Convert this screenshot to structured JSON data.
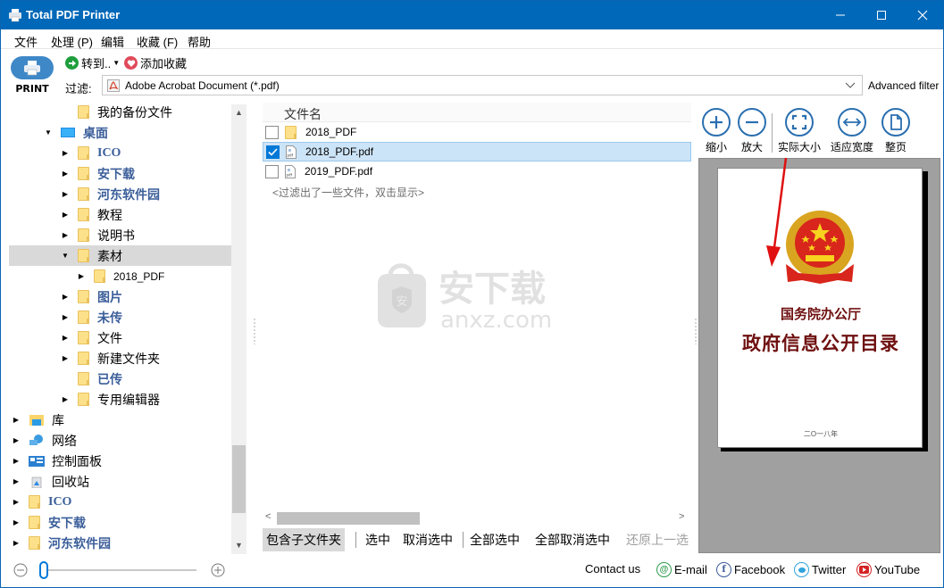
{
  "window": {
    "title": "Total PDF Printer",
    "controls": [
      "minimize",
      "maximize",
      "close"
    ]
  },
  "menu": [
    "文件",
    "处理 (P)",
    "编辑",
    "收藏 (F)",
    "帮助"
  ],
  "toolbar": {
    "print_label": "PRINT",
    "goto_label": "转到..",
    "add_favorite_label": "添加收藏",
    "filter_label": "过滤:",
    "filter_value": "Adobe Acrobat Document (*.pdf)",
    "advanced_filter_label": "Advanced filter"
  },
  "tree": {
    "items": [
      {
        "label": "我的备份文件",
        "expander": "none",
        "style": "normal"
      },
      {
        "label": "桌面",
        "expander": "expanded",
        "style": "bold-blue"
      },
      {
        "label": "ICO",
        "expander": "collapsed",
        "style": "bold-blue-serif"
      },
      {
        "label": "安下载",
        "expander": "collapsed",
        "style": "bold-blue"
      },
      {
        "label": "河东软件园",
        "expander": "collapsed",
        "style": "bold-blue"
      },
      {
        "label": "教程",
        "expander": "collapsed",
        "style": "normal"
      },
      {
        "label": "说明书",
        "expander": "collapsed",
        "style": "normal"
      },
      {
        "label": "素材",
        "expander": "expanded",
        "style": "normal",
        "selected": true
      },
      {
        "label": "2018_PDF",
        "expander": "collapsed",
        "style": "normal"
      },
      {
        "label": "图片",
        "expander": "collapsed",
        "style": "bold-blue"
      },
      {
        "label": "未传",
        "expander": "collapsed",
        "style": "bold-blue"
      },
      {
        "label": "文件",
        "expander": "collapsed",
        "style": "normal"
      },
      {
        "label": "新建文件夹",
        "expander": "collapsed",
        "style": "normal"
      },
      {
        "label": "已传",
        "expander": "none",
        "style": "bold-blue"
      },
      {
        "label": "专用编辑器",
        "expander": "collapsed",
        "style": "normal"
      },
      {
        "label": "库",
        "expander": "collapsed",
        "style": "normal"
      },
      {
        "label": "网络",
        "expander": "collapsed",
        "style": "normal"
      },
      {
        "label": "控制面板",
        "expander": "collapsed",
        "style": "normal"
      },
      {
        "label": "回收站",
        "expander": "collapsed",
        "style": "normal"
      },
      {
        "label": "ICO",
        "expander": "collapsed",
        "style": "bold-blue-serif"
      },
      {
        "label": "安下载",
        "expander": "collapsed",
        "style": "bold-blue"
      },
      {
        "label": "河东软件园",
        "expander": "collapsed",
        "style": "bold-blue"
      }
    ]
  },
  "filelist": {
    "column_header": "文件名",
    "rows": [
      {
        "name": "2018_PDF",
        "type": "folder",
        "checked": false,
        "selected": false
      },
      {
        "name": "2018_PDF.pdf",
        "type": "pdf",
        "checked": true,
        "selected": true
      },
      {
        "name": "2019_PDF.pdf",
        "type": "pdf",
        "checked": false,
        "selected": false
      }
    ],
    "filter_hint": "<过滤出了一些文件，双击显示>"
  },
  "watermark": {
    "cn": "安下载",
    "en": "anxz.com"
  },
  "actions": {
    "include_subfolders": "包含子文件夹",
    "select": "选中",
    "deselect": "取消选中",
    "select_all": "全部选中",
    "deselect_all": "全部取消选中",
    "restore_previous": "还原上一选"
  },
  "preview": {
    "buttons": {
      "zoom_out": "缩小",
      "zoom_in": "放大",
      "actual_size": "实际大小",
      "fit_width": "适应宽度",
      "full_page": "整页"
    },
    "page": {
      "line1": "国务院办公厅",
      "line2": "政府信息公开目录",
      "year": "二O一八年"
    }
  },
  "footer": {
    "contact_label": "Contact us",
    "links": {
      "email": "E-mail",
      "facebook": "Facebook",
      "twitter": "Twitter",
      "youtube": "YouTube"
    }
  },
  "colors": {
    "titlebar": "#0068b8",
    "accent": "#2a6fb0",
    "selected_row": "#cce4f7",
    "tree_bold_label": "#3b5e9a",
    "page_title": "#6e0f0f"
  }
}
